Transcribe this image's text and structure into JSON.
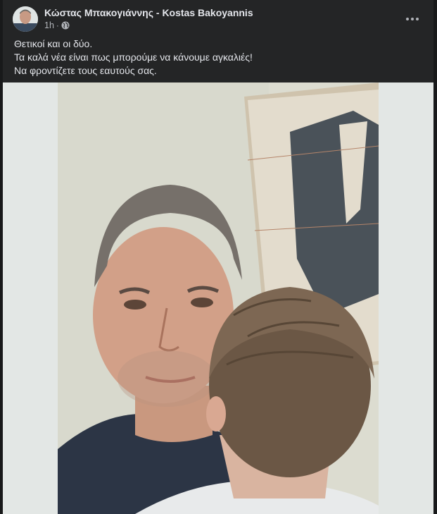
{
  "post": {
    "author_name": "Κώστας Μπακογιάννης - Kostas Bakoyannis",
    "time": "1h",
    "separator": "·",
    "privacy_icon": "globe-icon",
    "more_icon": "more-options-icon",
    "caption_lines": [
      "Θετικοί και οι δύο.",
      "Τα καλά νέα είναι πως μπορούμε να κάνουμε αγκαλιές!",
      "Να φροντίζετε τους εαυτούς σας."
    ]
  },
  "colors": {
    "background": "#18191a",
    "card": "#242526",
    "text_primary": "#e4e6eb",
    "text_secondary": "#b0b3b8",
    "photo_backdrop": "#e3e7e5"
  }
}
